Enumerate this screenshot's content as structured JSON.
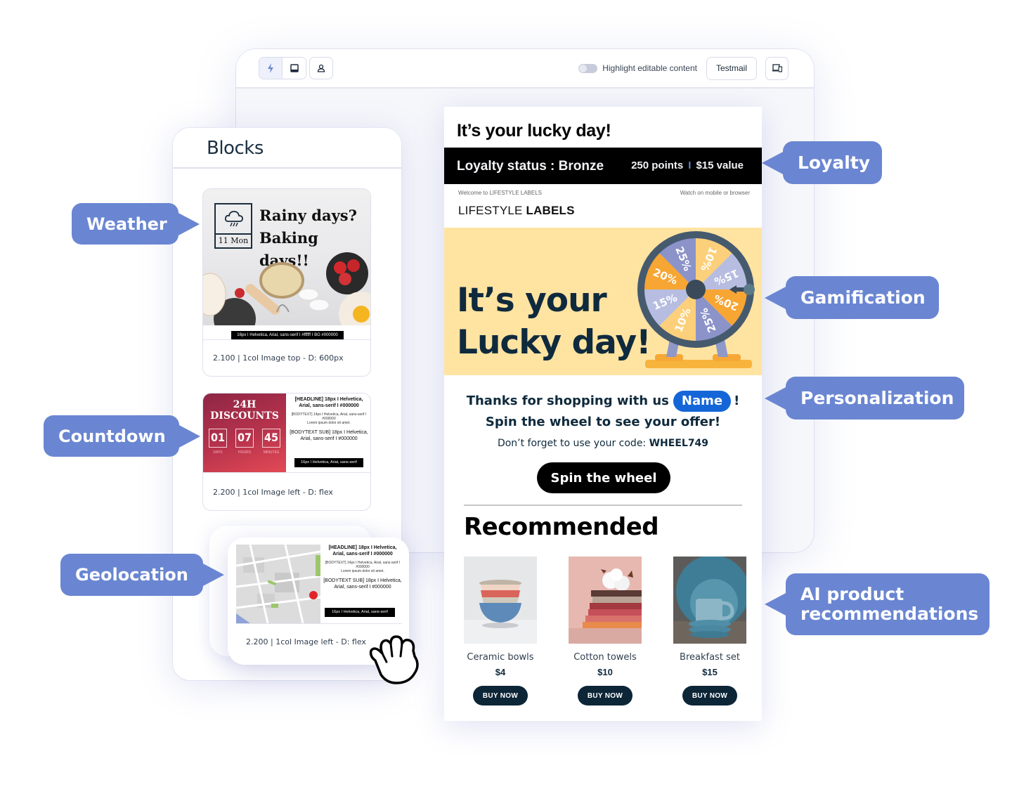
{
  "toolbar": {
    "buttons": [
      {
        "icon": "lightning-icon",
        "active": true
      },
      {
        "icon": "inbox-icon",
        "active": false
      },
      {
        "icon": "user-icon",
        "active": false
      }
    ],
    "highlight_toggle_label": "Highlight editable content",
    "highlight_toggle_on": false,
    "testmail_label": "Testmail",
    "device_icon": "device-preview-icon"
  },
  "blocks_panel": {
    "title": "Blocks",
    "items": [
      {
        "type": "weather",
        "weather_date": "11 Mon",
        "headline_1": "Rainy days?",
        "headline_2": "Baking days!!",
        "spec": "16px I Helvetica, Arial, sans-serif I #ffffff I BG #000000",
        "caption": "2.100 | 1col Image top - D: 600px"
      },
      {
        "type": "countdown",
        "title_1": "24H",
        "title_2": "DISCOUNTS",
        "digits": [
          "01",
          "07",
          "45"
        ],
        "units": [
          "DAYS",
          "HOURS",
          "MINUTES"
        ],
        "headline": "[HEADLINE] 18px I Helvetica, Arial, sans-serif I #000000",
        "bodytext": "[BODYTEXT] 14px I Helvetica, Arial, sans-serif I #000000",
        "lorem": "Lorem ipsum dolor sit amet.",
        "bodytext_sub": "[BODYTEXT SUB] 18px I Helvetica, Arial, sans-serif I #000000",
        "button_spec": "16px I Helvetica, Arial, sans-serif",
        "caption": "2.200 | 1col Image left - D: flex"
      },
      {
        "type": "geolocation",
        "headline": "[HEADLINE] 18px I Helvetica, Arial, sans-serif I #000000",
        "bodytext": "[BODYTEXT] 14px I Helvetica, Arial, sans-serif I #000000",
        "lorem": "Lorem ipsum dolor sit amet.",
        "bodytext_sub": "[BODYTEXT SUB] 18px I Helvetica, Arial, sans-serif I #000000",
        "button_spec": "16px I Helvetica, Arial, sans-serif",
        "caption": "2.200 | 1col Image left - D: flex"
      }
    ]
  },
  "email": {
    "title": "It’s your lucky day!",
    "loyalty": {
      "status": "Loyalty status : Bronze",
      "points": "250 points",
      "separator": "I",
      "value": "$15 value"
    },
    "preheader_left": "Welcome to LIFESTYLE LABELS",
    "preheader_right": "Watch on mobile or browser",
    "brand_light": "LIFESTYLE ",
    "brand_bold": "LABELS",
    "hero": {
      "line1": "It’s your",
      "line2": "Lucky day!",
      "wheel_segments": [
        "10%",
        "15%",
        "20%",
        "25%",
        "10%",
        "15%",
        "20%",
        "25%"
      ]
    },
    "thanks_prefix": "Thanks for shopping with us",
    "name_token": "Name",
    "thanks_suffix": "!",
    "spin_prompt": "Spin the wheel to see your offer!",
    "code_prefix": "Don’t forget to use your code:",
    "code": "WHEEL749",
    "spin_button": "Spin the wheel",
    "recommended_title": "Recommended",
    "products": [
      {
        "name": "Ceramic bowls",
        "price": "$4",
        "button": "BUY NOW"
      },
      {
        "name": "Cotton towels",
        "price": "$10",
        "button": "BUY NOW"
      },
      {
        "name": "Breakfast set",
        "price": "$15",
        "button": "BUY NOW"
      }
    ]
  },
  "callouts": {
    "weather": "Weather",
    "countdown": "Countdown",
    "geolocation": "Geolocation",
    "loyalty": "Loyalty",
    "gamification": "Gamification",
    "personalization": "Personalization",
    "ai_line1": "AI product",
    "ai_line2": "recommendations"
  },
  "colors": {
    "callout": "#6a86d2",
    "name_pill": "#1466d8",
    "hero_bg": "#ffe3a1",
    "buy_button": "#0c2537"
  }
}
